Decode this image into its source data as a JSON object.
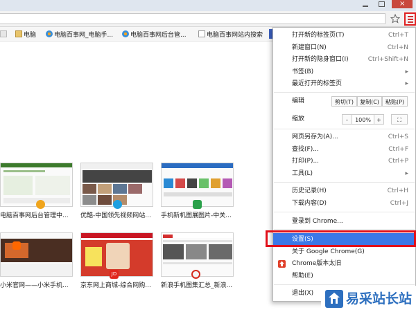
{
  "browser": {
    "accent_color": "#3b78e7",
    "highlight_color": "#e1101a",
    "bookmarks": [
      {
        "icon": "folder-icon",
        "label": ""
      },
      {
        "icon": "folder-icon",
        "label": "电脑"
      },
      {
        "icon": "site-icon",
        "label": "电脑百事网_电脑手..."
      },
      {
        "icon": "site-icon",
        "label": "电脑百事网后台管..."
      },
      {
        "icon": "page-icon",
        "label": "电脑百事网站内搜索"
      }
    ]
  },
  "thumbnails": [
    {
      "label": "电脑百事网后台管理中..."
    },
    {
      "label": "优酷-中国领先视频网站..."
    },
    {
      "label": "手机新机图展图片-中关..."
    },
    {
      "label": "小米官网——小米手机..."
    },
    {
      "label": "京东网上商城-综合网购..."
    },
    {
      "label": "新浪手机图集汇总_新浪..."
    }
  ],
  "menu": {
    "items_top": [
      {
        "label": "打开新的标签页(T)",
        "shortcut": "Ctrl+T"
      },
      {
        "label": "新建窗口(N)",
        "shortcut": "Ctrl+N"
      },
      {
        "label": "打开新的隐身窗口(I)",
        "shortcut": "Ctrl+Shift+N"
      },
      {
        "label": "书签(B)",
        "shortcut": "▸"
      },
      {
        "label": "最近打开的标签页",
        "shortcut": "▸"
      }
    ],
    "edit": {
      "label": "编辑",
      "cut": "剪切(T)",
      "copy": "复制(C)",
      "paste": "粘贴(P)"
    },
    "zoom": {
      "label": "缩放",
      "minus": "-",
      "value": "100%",
      "plus": "+",
      "fullscreen": "⛶"
    },
    "items_mid": [
      {
        "label": "网页另存为(A)...",
        "shortcut": "Ctrl+S"
      },
      {
        "label": "查找(F)...",
        "shortcut": "Ctrl+F"
      },
      {
        "label": "打印(P)...",
        "shortcut": "Ctrl+P"
      },
      {
        "label": "工具(L)",
        "shortcut": "▸"
      }
    ],
    "items_hist": [
      {
        "label": "历史记录(H)",
        "shortcut": "Ctrl+H"
      },
      {
        "label": "下载内容(D)",
        "shortcut": "Ctrl+J"
      }
    ],
    "signin": "登录到 Chrome...",
    "settings": "设置(S)",
    "about": "关于 Google Chrome(G)",
    "old_version": "Chrome版本太旧",
    "help": "帮助(E)",
    "exit": "退出(X)"
  },
  "watermark": {
    "text": "易采站长站"
  }
}
